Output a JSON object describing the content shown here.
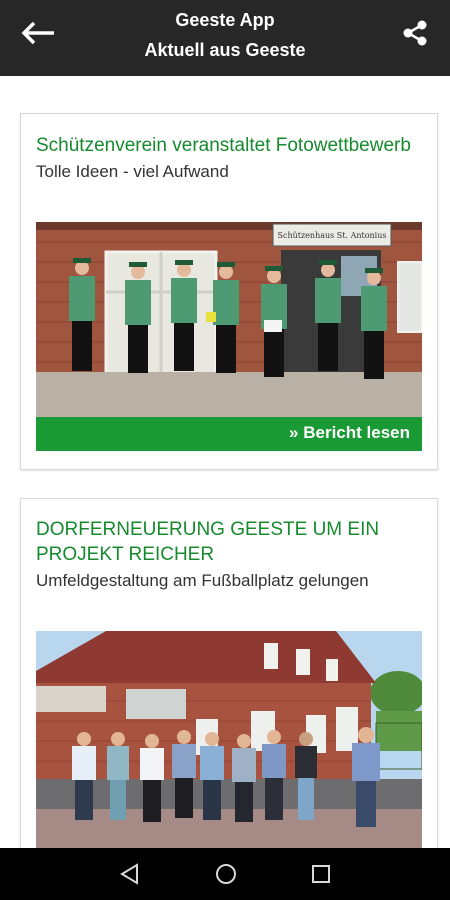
{
  "header": {
    "app_title": "Geeste App",
    "section_title": "Aktuell aus Geeste",
    "back_icon": "arrow-left-icon",
    "share_icon": "share-icon"
  },
  "articles": [
    {
      "title": "Schützenverein veranstaltet Fotowettbewerb",
      "subtitle": "Tolle Ideen - viel Aufwand",
      "image_sign": "Schützenhaus St. Antonius",
      "read_more": "» Bericht lesen"
    },
    {
      "title": "DORFERNEUERUNG GEESTE UM EIN PROJEKT REICHER",
      "subtitle": "Umfeldgestaltung am Fußballplatz gelungen"
    }
  ],
  "nav": {
    "back": "triangle-back-icon",
    "home": "circle-home-icon",
    "recents": "square-recents-icon"
  },
  "colors": {
    "header_bg": "#272727",
    "title_green": "#178a2e",
    "button_green": "#1a9a34"
  }
}
